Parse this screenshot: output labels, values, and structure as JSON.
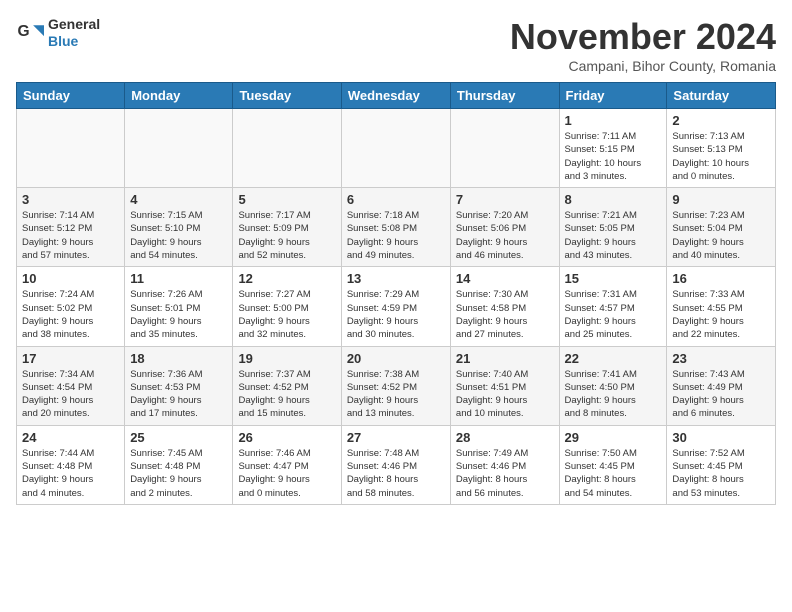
{
  "header": {
    "logo": {
      "line1": "General",
      "line2": "Blue"
    },
    "title": "November 2024",
    "location": "Campani, Bihor County, Romania"
  },
  "weekdays": [
    "Sunday",
    "Monday",
    "Tuesday",
    "Wednesday",
    "Thursday",
    "Friday",
    "Saturday"
  ],
  "weeks": [
    [
      {
        "day": "",
        "info": ""
      },
      {
        "day": "",
        "info": ""
      },
      {
        "day": "",
        "info": ""
      },
      {
        "day": "",
        "info": ""
      },
      {
        "day": "",
        "info": ""
      },
      {
        "day": "1",
        "info": "Sunrise: 7:11 AM\nSunset: 5:15 PM\nDaylight: 10 hours\nand 3 minutes."
      },
      {
        "day": "2",
        "info": "Sunrise: 7:13 AM\nSunset: 5:13 PM\nDaylight: 10 hours\nand 0 minutes."
      }
    ],
    [
      {
        "day": "3",
        "info": "Sunrise: 7:14 AM\nSunset: 5:12 PM\nDaylight: 9 hours\nand 57 minutes."
      },
      {
        "day": "4",
        "info": "Sunrise: 7:15 AM\nSunset: 5:10 PM\nDaylight: 9 hours\nand 54 minutes."
      },
      {
        "day": "5",
        "info": "Sunrise: 7:17 AM\nSunset: 5:09 PM\nDaylight: 9 hours\nand 52 minutes."
      },
      {
        "day": "6",
        "info": "Sunrise: 7:18 AM\nSunset: 5:08 PM\nDaylight: 9 hours\nand 49 minutes."
      },
      {
        "day": "7",
        "info": "Sunrise: 7:20 AM\nSunset: 5:06 PM\nDaylight: 9 hours\nand 46 minutes."
      },
      {
        "day": "8",
        "info": "Sunrise: 7:21 AM\nSunset: 5:05 PM\nDaylight: 9 hours\nand 43 minutes."
      },
      {
        "day": "9",
        "info": "Sunrise: 7:23 AM\nSunset: 5:04 PM\nDaylight: 9 hours\nand 40 minutes."
      }
    ],
    [
      {
        "day": "10",
        "info": "Sunrise: 7:24 AM\nSunset: 5:02 PM\nDaylight: 9 hours\nand 38 minutes."
      },
      {
        "day": "11",
        "info": "Sunrise: 7:26 AM\nSunset: 5:01 PM\nDaylight: 9 hours\nand 35 minutes."
      },
      {
        "day": "12",
        "info": "Sunrise: 7:27 AM\nSunset: 5:00 PM\nDaylight: 9 hours\nand 32 minutes."
      },
      {
        "day": "13",
        "info": "Sunrise: 7:29 AM\nSunset: 4:59 PM\nDaylight: 9 hours\nand 30 minutes."
      },
      {
        "day": "14",
        "info": "Sunrise: 7:30 AM\nSunset: 4:58 PM\nDaylight: 9 hours\nand 27 minutes."
      },
      {
        "day": "15",
        "info": "Sunrise: 7:31 AM\nSunset: 4:57 PM\nDaylight: 9 hours\nand 25 minutes."
      },
      {
        "day": "16",
        "info": "Sunrise: 7:33 AM\nSunset: 4:55 PM\nDaylight: 9 hours\nand 22 minutes."
      }
    ],
    [
      {
        "day": "17",
        "info": "Sunrise: 7:34 AM\nSunset: 4:54 PM\nDaylight: 9 hours\nand 20 minutes."
      },
      {
        "day": "18",
        "info": "Sunrise: 7:36 AM\nSunset: 4:53 PM\nDaylight: 9 hours\nand 17 minutes."
      },
      {
        "day": "19",
        "info": "Sunrise: 7:37 AM\nSunset: 4:52 PM\nDaylight: 9 hours\nand 15 minutes."
      },
      {
        "day": "20",
        "info": "Sunrise: 7:38 AM\nSunset: 4:52 PM\nDaylight: 9 hours\nand 13 minutes."
      },
      {
        "day": "21",
        "info": "Sunrise: 7:40 AM\nSunset: 4:51 PM\nDaylight: 9 hours\nand 10 minutes."
      },
      {
        "day": "22",
        "info": "Sunrise: 7:41 AM\nSunset: 4:50 PM\nDaylight: 9 hours\nand 8 minutes."
      },
      {
        "day": "23",
        "info": "Sunrise: 7:43 AM\nSunset: 4:49 PM\nDaylight: 9 hours\nand 6 minutes."
      }
    ],
    [
      {
        "day": "24",
        "info": "Sunrise: 7:44 AM\nSunset: 4:48 PM\nDaylight: 9 hours\nand 4 minutes."
      },
      {
        "day": "25",
        "info": "Sunrise: 7:45 AM\nSunset: 4:48 PM\nDaylight: 9 hours\nand 2 minutes."
      },
      {
        "day": "26",
        "info": "Sunrise: 7:46 AM\nSunset: 4:47 PM\nDaylight: 9 hours\nand 0 minutes."
      },
      {
        "day": "27",
        "info": "Sunrise: 7:48 AM\nSunset: 4:46 PM\nDaylight: 8 hours\nand 58 minutes."
      },
      {
        "day": "28",
        "info": "Sunrise: 7:49 AM\nSunset: 4:46 PM\nDaylight: 8 hours\nand 56 minutes."
      },
      {
        "day": "29",
        "info": "Sunrise: 7:50 AM\nSunset: 4:45 PM\nDaylight: 8 hours\nand 54 minutes."
      },
      {
        "day": "30",
        "info": "Sunrise: 7:52 AM\nSunset: 4:45 PM\nDaylight: 8 hours\nand 53 minutes."
      }
    ]
  ]
}
